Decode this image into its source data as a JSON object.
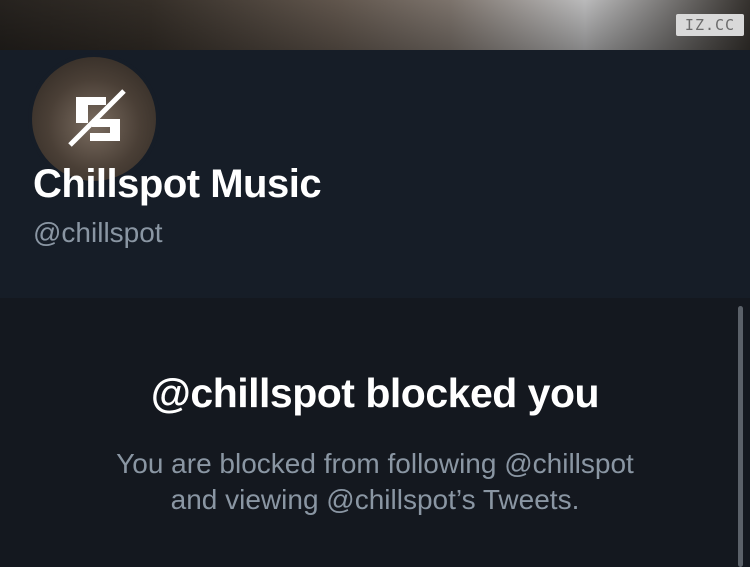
{
  "banner": {
    "plate_text": "IZ.CC"
  },
  "profile": {
    "name": "Chillspot Music",
    "handle": "@chillspot",
    "avatar_icon": "chillspot-logo-icon"
  },
  "blocked": {
    "title": "@chillspot blocked you",
    "line1": "You are blocked from following @chillspot",
    "line2": "and viewing @chillspot’s Tweets."
  },
  "colors": {
    "profile_bg": "#161d27",
    "page_bg": "#14181f",
    "secondary_text": "#8a96a3",
    "primary_text": "#ffffff"
  }
}
